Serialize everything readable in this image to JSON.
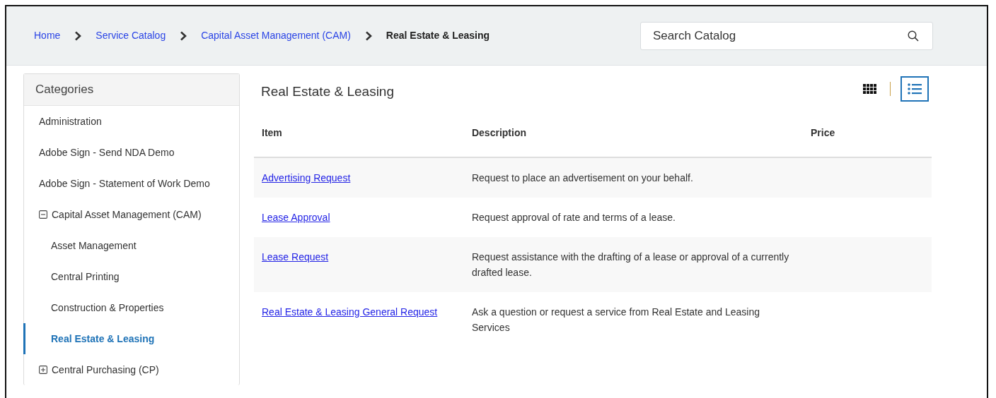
{
  "breadcrumb": [
    {
      "label": "Home",
      "current": false
    },
    {
      "label": "Service Catalog",
      "current": false
    },
    {
      "label": "Capital Asset Management (CAM)",
      "current": false
    },
    {
      "label": "Real Estate & Leasing",
      "current": true
    }
  ],
  "search": {
    "placeholder": "Search Catalog"
  },
  "sidebar": {
    "title": "Categories",
    "items": [
      {
        "label": "Administration",
        "selected": false
      },
      {
        "label": "Adobe Sign - Send NDA Demo",
        "selected": false
      },
      {
        "label": "Adobe Sign - Statement of Work Demo",
        "selected": false
      },
      {
        "label": "Capital Asset Management (CAM)",
        "selected": false,
        "expanded": true,
        "children": [
          {
            "label": "Asset Management",
            "selected": false
          },
          {
            "label": "Central Printing",
            "selected": false
          },
          {
            "label": "Construction & Properties",
            "selected": false
          },
          {
            "label": "Real Estate & Leasing",
            "selected": true
          }
        ]
      },
      {
        "label": "Central Purchasing (CP)",
        "selected": false,
        "expanded": false
      }
    ]
  },
  "main": {
    "title": "Real Estate & Leasing",
    "views": [
      {
        "kind": "grid",
        "selected": false
      },
      {
        "kind": "list",
        "selected": true
      }
    ],
    "table": {
      "columns": [
        "Item",
        "Description",
        "Price"
      ],
      "rows": [
        {
          "item": "Advertising Request",
          "description": "Request to place an advertisement on your behalf."
        },
        {
          "item": "Lease Approval",
          "description": "Request approval of rate and terms of a lease."
        },
        {
          "item": "Lease Request",
          "description": "Request assistance with the drafting of a lease or approval of a currently drafted lease."
        },
        {
          "item": "Real Estate & Leasing General Request",
          "description": "Ask a question or request a service from Real Estate and Leasing Services"
        }
      ]
    }
  }
}
